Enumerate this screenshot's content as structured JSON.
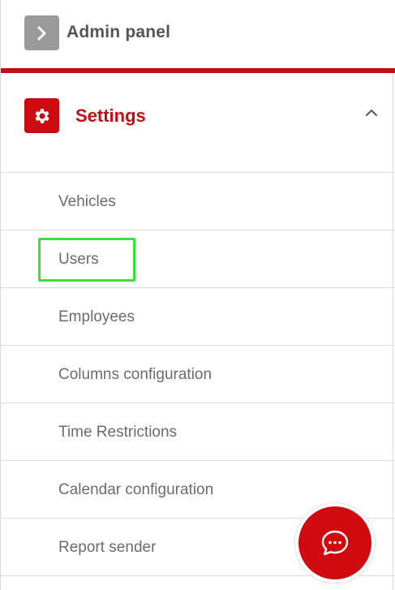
{
  "header": {
    "title": "Admin panel",
    "toggle_icon": "chevron-right-icon"
  },
  "section": {
    "title": "Settings",
    "icon": "gear-icon",
    "chevron": "chevron-up-icon",
    "accent_color": "#c20f12"
  },
  "menu": {
    "items": [
      {
        "label": "Vehicles"
      },
      {
        "label": "Users"
      },
      {
        "label": "Employees"
      },
      {
        "label": "Columns configuration"
      },
      {
        "label": "Time Restrictions"
      },
      {
        "label": "Calendar configuration"
      },
      {
        "label": "Report sender"
      }
    ],
    "highlighted": "Users"
  },
  "chat": {
    "icon": "chat-bubble-icon"
  }
}
